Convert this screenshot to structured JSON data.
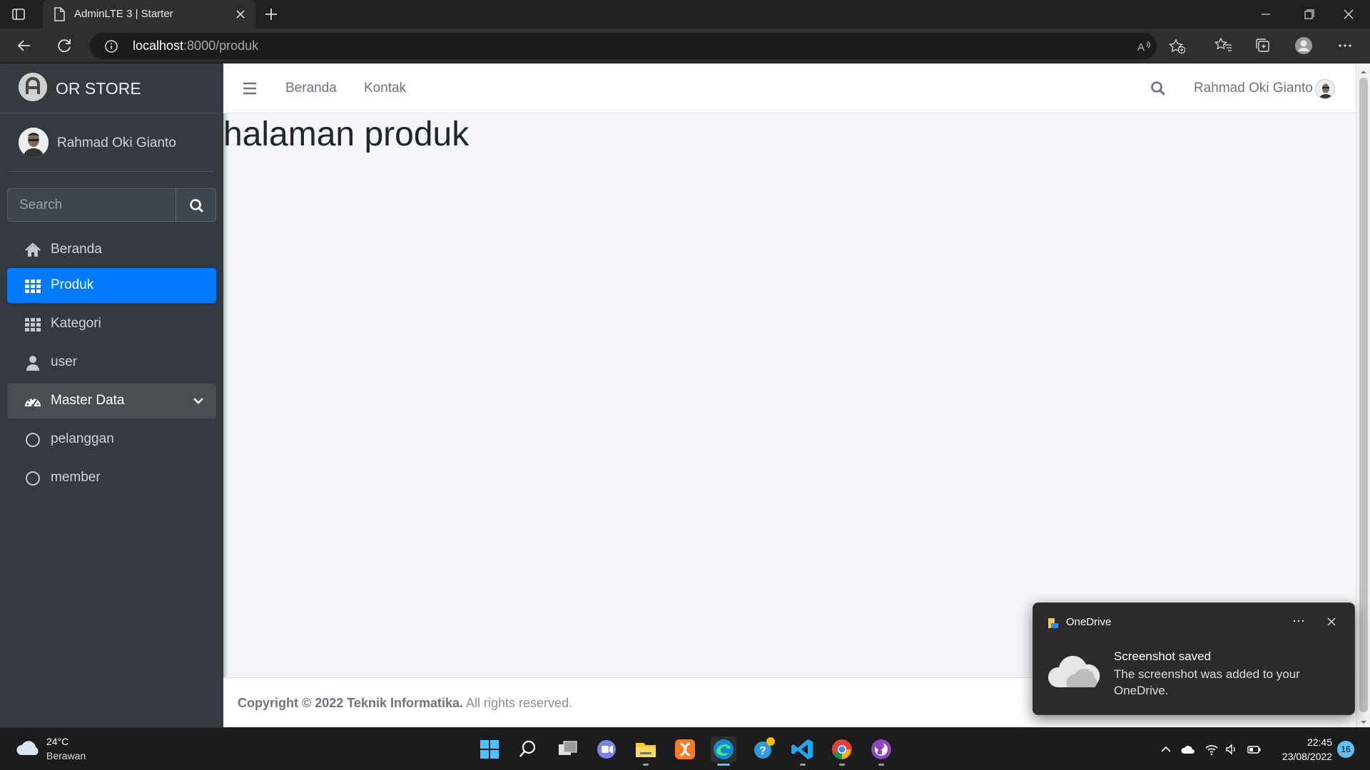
{
  "browser": {
    "tab_title": "AdminLTE 3 | Starter",
    "url_host": "localhost",
    "url_path": ":8000/produk"
  },
  "sidebar": {
    "brand": "OR STORE",
    "user_name": "Rahmad Oki Gianto",
    "search_placeholder": "Search",
    "items": [
      {
        "label": "Beranda",
        "icon": "home-icon"
      },
      {
        "label": "Produk",
        "icon": "grid-icon",
        "state": "active"
      },
      {
        "label": "Kategori",
        "icon": "grid-icon"
      },
      {
        "label": "user",
        "icon": "user-icon"
      },
      {
        "label": "Master Data",
        "icon": "dashboard-gauge-icon",
        "state": "open"
      },
      {
        "label": "pelanggan",
        "icon": "circle-icon"
      },
      {
        "label": "member",
        "icon": "circle-icon"
      }
    ]
  },
  "topnav": {
    "links": [
      "Beranda",
      "Kontak"
    ],
    "user_name": "Rahmad Oki Gianto"
  },
  "content": {
    "heading": "halaman produk"
  },
  "footer": {
    "copyright_bold": "Copyright © 2022 Teknik Informatika.",
    "copyright_rest": " All rights reserved."
  },
  "toast": {
    "app": "OneDrive",
    "title": "Screenshot saved",
    "body": "The screenshot was added to your OneDrive."
  },
  "taskbar": {
    "temperature": "24°C",
    "weather": "Berawan",
    "time": "22:45",
    "date": "23/08/2022",
    "notifications": "16"
  },
  "colors": {
    "accent": "#007bff",
    "sidebar_bg": "#343a40",
    "content_bg": "#f4f6f9"
  }
}
